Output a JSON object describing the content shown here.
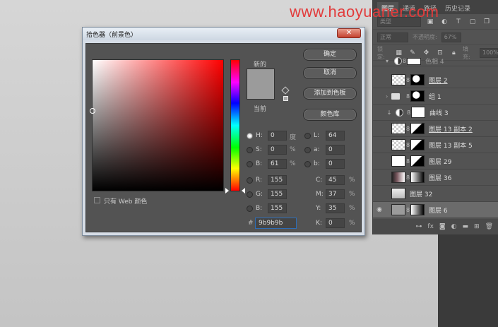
{
  "watermark": "www.haoyuaner.com",
  "layers_panel": {
    "tabs": [
      "图层",
      "通道",
      "路径",
      "历史记录"
    ],
    "filter_placeholder": "类型",
    "blend_mode": "正常",
    "opacity_label": "不透明度:",
    "opacity_value": "67%",
    "lock_label": "锁定:",
    "fill_label": "填充:",
    "fill_value": "100%",
    "top_row_name": "色相 4",
    "layers": [
      {
        "name": "图层 2"
      },
      {
        "name": "组 1"
      },
      {
        "name": "曲线 3"
      },
      {
        "name": "图层 13 副本 2"
      },
      {
        "name": "图层 13 副本 5"
      },
      {
        "name": "图层 29"
      },
      {
        "name": "图层 36"
      },
      {
        "name": "图层 32"
      },
      {
        "name": "图层 6"
      }
    ],
    "footer_icons": [
      "link-icon",
      "fx-icon",
      "mask-icon",
      "adjustment-icon",
      "folder-icon",
      "new-layer-icon",
      "trash-icon"
    ]
  },
  "dialog": {
    "title": "拾色器（前景色）",
    "close": "✕",
    "new_label": "新的",
    "current_label": "当前",
    "current_color": "#9b9b9b",
    "buttons": {
      "ok": "确定",
      "cancel": "取消",
      "add_swatch": "添加到色板",
      "libraries": "颜色库"
    },
    "hsb": {
      "h": "0",
      "s": "0",
      "b": "61",
      "h_unit": "度",
      "s_unit": "%",
      "b_unit": "%"
    },
    "rgb": {
      "r": "155",
      "g": "155",
      "b": "155"
    },
    "lab": {
      "l": "64",
      "a": "0",
      "b": "0"
    },
    "cmyk": {
      "c": "45",
      "m": "37",
      "y": "35",
      "k": "0",
      "unit": "%"
    },
    "hex": "9b9b9b",
    "web_only": "只有 Web 颜色",
    "labels": {
      "H": "H:",
      "S": "S:",
      "B": "B:",
      "R": "R:",
      "G": "G:",
      "Bb": "B:",
      "L": "L:",
      "a": "a:",
      "b": "b:",
      "C": "C:",
      "M": "M:",
      "Y": "Y:",
      "K": "K:",
      "hash": "#"
    }
  }
}
